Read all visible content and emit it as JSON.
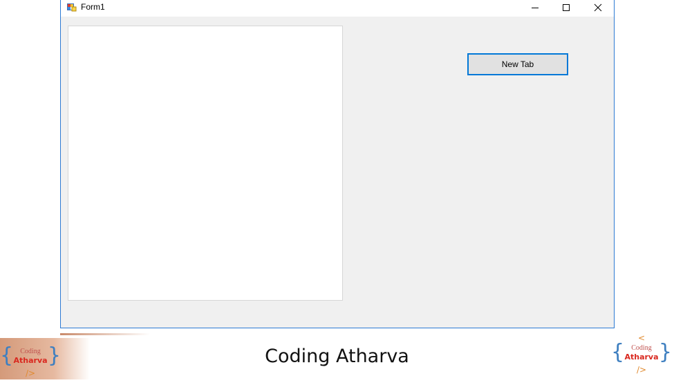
{
  "window": {
    "title": "Form1",
    "icon": "winforms-app-icon",
    "controls": {
      "minimize": "minimize-icon",
      "maximize": "maximize-icon",
      "close": "close-icon"
    }
  },
  "form": {
    "new_tab_button": "New Tab"
  },
  "footer": {
    "title": "Coding Atharva",
    "logo": {
      "open_tag": "<",
      "line1": "Coding",
      "line2": "Atharva",
      "close_tag": "/>"
    }
  },
  "colors": {
    "window_border": "#2b79d3",
    "form_background": "#f0f0f0",
    "button_focus_border": "#0078d7",
    "logo_brace": "#3e7fc0",
    "logo_text": "#d9281f",
    "logo_tag": "#e08a2f"
  }
}
